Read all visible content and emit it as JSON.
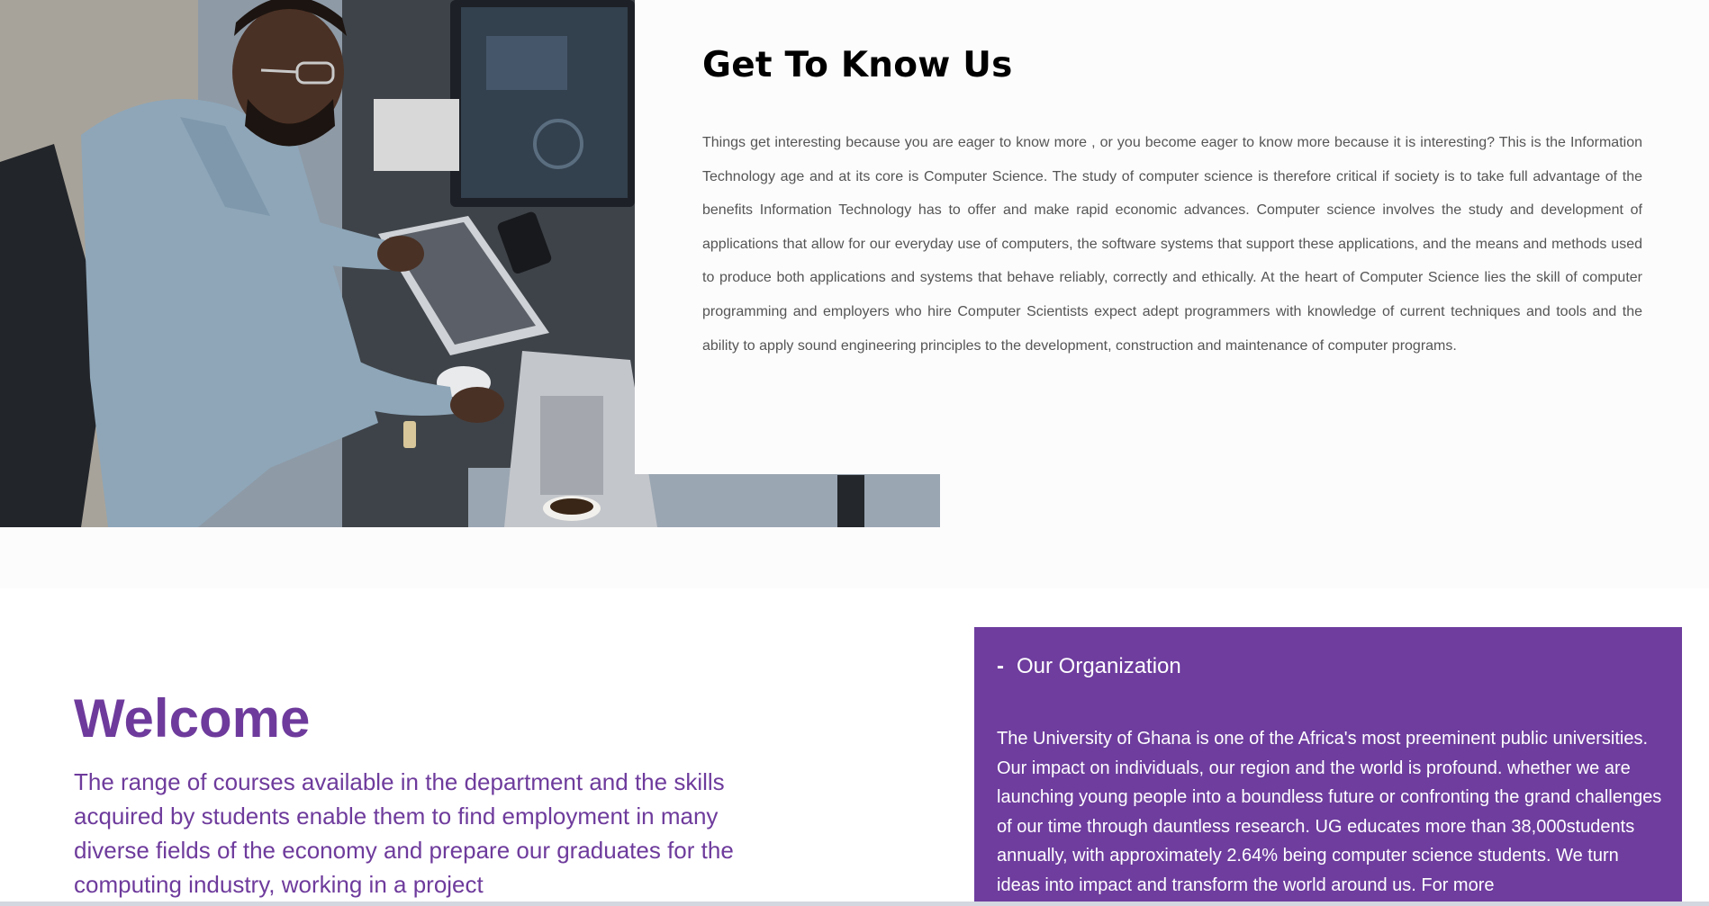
{
  "about": {
    "title": "Get To Know Us",
    "paragraph": "Things get interesting because you are eager to know more , or you become eager to know more because it is interesting? This is the Information Technology age and at its core is Computer Science. The study of computer science is therefore critical if society is to take full advantage of the benefits Information Technology has to offer and make rapid economic advances. Computer science involves the study and development of applications that allow for our everyday use of computers, the software systems that support these applications, and the means and methods used to produce both applications and systems that behave reliably, correctly and ethically. At the heart of Computer Science lies the skill of computer programming and employers who hire Computer Scientists expect adept programmers with knowledge of current techniques and tools and the ability to apply sound engineering principles to the development, construction and maintenance of computer programs."
  },
  "welcome": {
    "title": "Welcome",
    "paragraph": "The range of courses available in the department and the skills acquired by students enable them to find employment in many diverse fields of the economy and prepare our graduates for the computing industry, working in a project"
  },
  "organization": {
    "toggle_symbol": "-",
    "heading": "Our Organization",
    "paragraph": "The University of Ghana is one of the Africa's most preeminent public universities. Our impact on individuals, our region and the world is profound. whether we are launching young people into a boundless future or confronting the grand challenges of our time through dauntless research. UG educates more than 38,000students annually, with approximately 2.64% being computer science students. We turn ideas into impact and transform the world around us. For more"
  },
  "colors": {
    "accent_purple": "#6e3b9c",
    "panel_purple": "#6e3d9e",
    "page_background": "#fdfcfd"
  }
}
